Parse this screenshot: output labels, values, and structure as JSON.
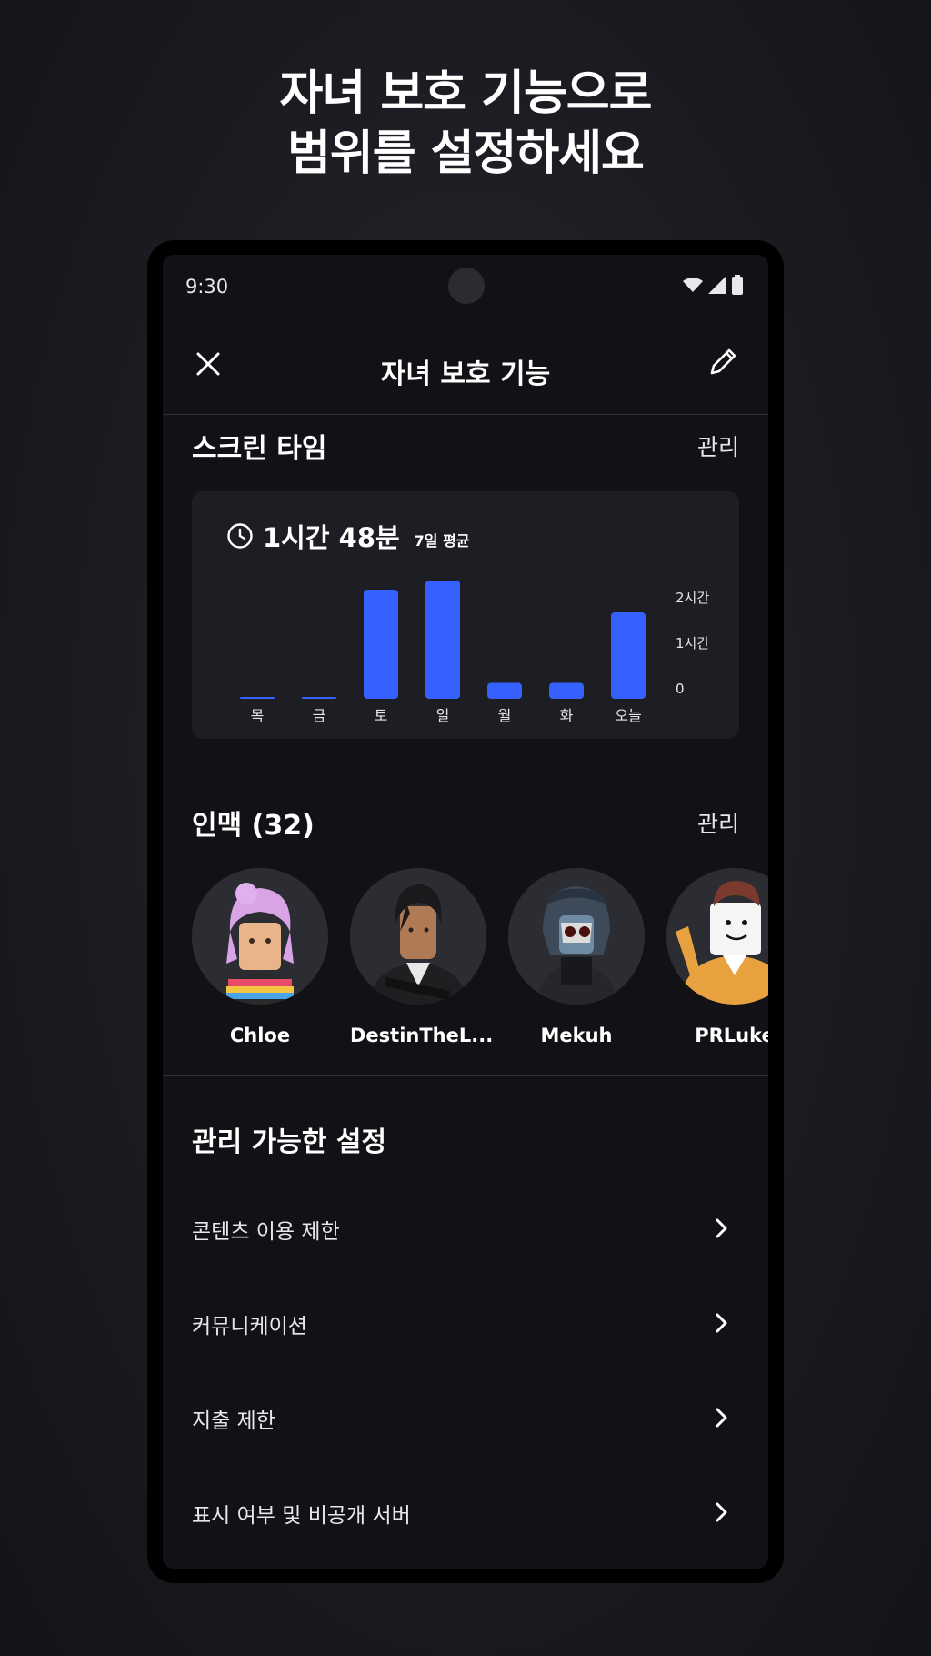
{
  "headline": {
    "line1": "자녀 보호 기능으로",
    "line2": "범위를 설정하세요"
  },
  "status_bar": {
    "time": "9:30",
    "icons": [
      "wifi-icon",
      "signal-icon",
      "battery-icon"
    ]
  },
  "app_bar": {
    "title": "자녀 보호 기능",
    "left_icon": "close-icon",
    "right_icon": "edit-pencil-icon"
  },
  "screen_time": {
    "title": "스크린 타임",
    "manage": "관리",
    "average_value": "1시간 48분",
    "average_label": "7일 평균"
  },
  "chart_data": {
    "type": "bar",
    "categories": [
      "목",
      "금",
      "토",
      "일",
      "월",
      "화",
      "오늘"
    ],
    "values": [
      0.01,
      0.01,
      2.4,
      2.6,
      0.35,
      0.35,
      1.9
    ],
    "y_unit": "hours",
    "y_tick_labels": [
      "2시간",
      "1시간",
      "0"
    ],
    "ylim": [
      0,
      2.6
    ],
    "bar_color": "#3461ff",
    "grid": false
  },
  "contacts": {
    "title": "인맥 (32)",
    "manage": "관리",
    "items": [
      {
        "name": "Chloe"
      },
      {
        "name": "DestinTheL..."
      },
      {
        "name": "Mekuh"
      },
      {
        "name": "PRLuke"
      }
    ]
  },
  "settings": {
    "title": "관리 가능한 설정",
    "items": [
      {
        "label": "콘텐츠 이용 제한"
      },
      {
        "label": "커뮤니케이션"
      },
      {
        "label": "지출 제한"
      },
      {
        "label": "표시 여부 및 비공개 서버"
      }
    ]
  },
  "colors": {
    "background": "#121216",
    "card": "#1d1e23",
    "accent": "#3461ff"
  }
}
